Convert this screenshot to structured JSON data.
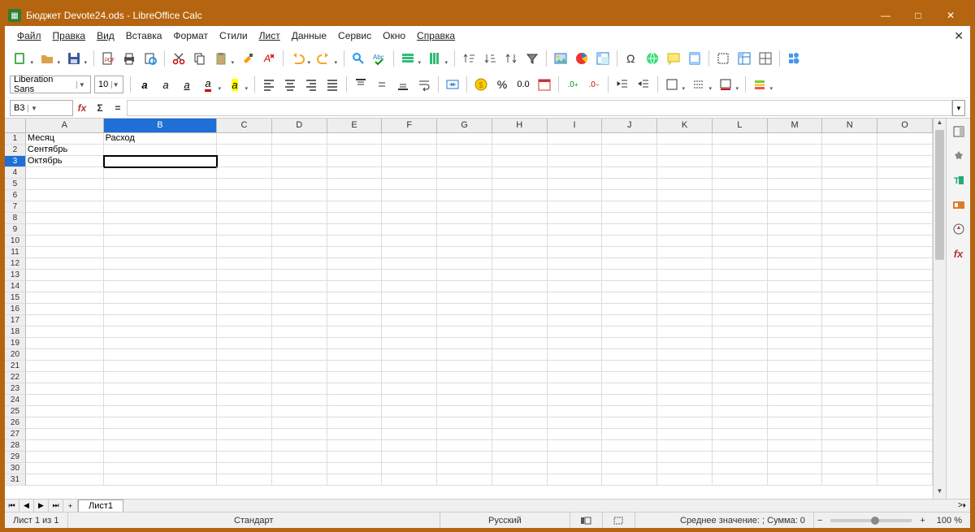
{
  "titlebar": {
    "title": "Бюджет Devote24.ods - LibreOffice Calc"
  },
  "menu": [
    "Файл",
    "Правка",
    "Вид",
    "Вставка",
    "Формат",
    "Стили",
    "Лист",
    "Данные",
    "Сервис",
    "Окно",
    "Справка"
  ],
  "font": {
    "name": "Liberation Sans",
    "size": "10"
  },
  "namebox": "B3",
  "columns": [
    "A",
    "B",
    "C",
    "D",
    "E",
    "F",
    "G",
    "H",
    "I",
    "J",
    "K",
    "L",
    "M",
    "N",
    "O"
  ],
  "col_widths": {
    "A": 96,
    "B": 140,
    "default": 68
  },
  "selected_col": "B",
  "selected_row": 3,
  "rows_visible": 31,
  "cells": {
    "A1": "Месяц",
    "B1": "Расход",
    "A2": "Сентябрь",
    "A3": "Октябрь"
  },
  "active_cell": "B3",
  "sheet_tab": "Лист1",
  "status": {
    "sheet_info": "Лист 1 из 1",
    "style": "Стандарт",
    "lang": "Русский",
    "aggregate": "Среднее значение: ; Сумма: 0",
    "zoom": "100 %"
  }
}
